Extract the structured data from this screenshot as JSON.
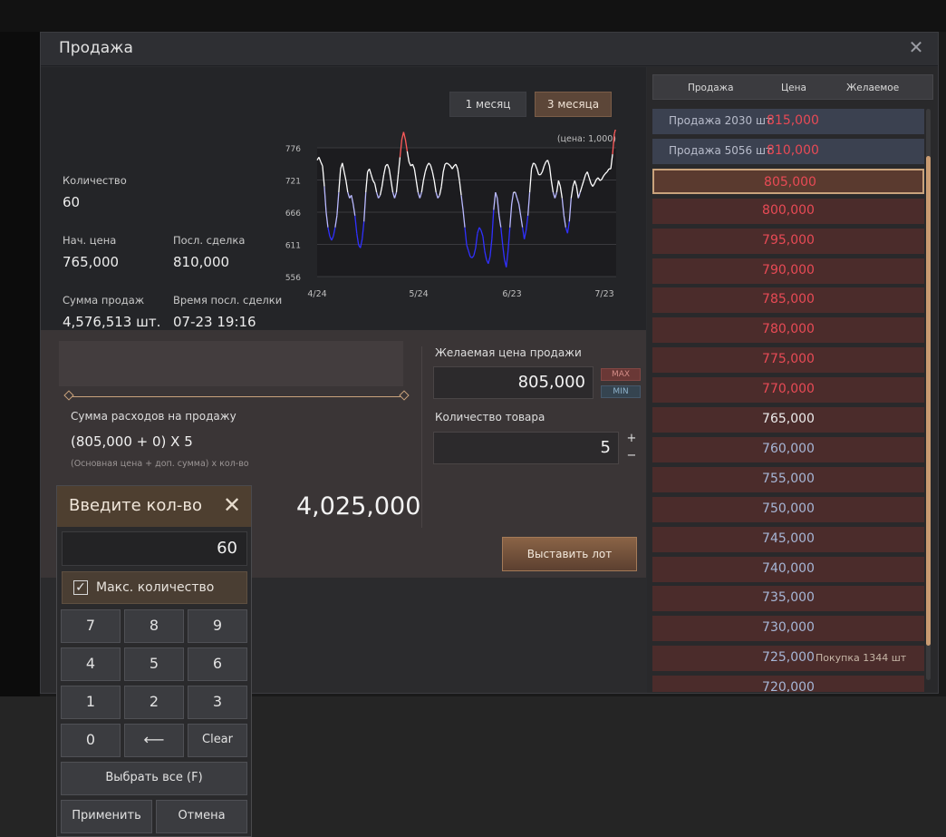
{
  "window": {
    "title": "Продажа"
  },
  "period_buttons": {
    "one_month": "1 месяц",
    "three_months": "3 месяца"
  },
  "stats": {
    "quantity_label": "Количество",
    "quantity_value": "60",
    "start_price_label": "Нач. цена",
    "start_price_value": "765,000",
    "last_deal_label": "Посл. сделка",
    "last_deal_value": "810,000",
    "sales_sum_label": "Сумма продаж",
    "sales_sum_value": "4,576,513 шт.",
    "last_deal_time_label": "Время посл. сделки",
    "last_deal_time_value": "07-23 19:16"
  },
  "chart_data": {
    "type": "line",
    "unit_note": "(цена: 1,000)",
    "y_ticks": [
      "776",
      "721",
      "666",
      "611",
      "556"
    ],
    "ylim": [
      556,
      776
    ],
    "x_ticks": [
      "4/24",
      "5/24",
      "6/23",
      "7/23"
    ],
    "reference_line": 765,
    "values": [
      755,
      760,
      752,
      745,
      710,
      666,
      640,
      625,
      618,
      625,
      640,
      660,
      700,
      740,
      750,
      735,
      720,
      700,
      690,
      695,
      680,
      660,
      630,
      610,
      605,
      620,
      650,
      700,
      735,
      740,
      730,
      720,
      715,
      700,
      690,
      695,
      710,
      730,
      745,
      748,
      740,
      720,
      700,
      690,
      700,
      730,
      760,
      790,
      803,
      790,
      770,
      752,
      745,
      748,
      740,
      720,
      700,
      690,
      700,
      720,
      735,
      745,
      750,
      746,
      735,
      720,
      700,
      690,
      695,
      710,
      735,
      748,
      750,
      748,
      745,
      740,
      745,
      748,
      740,
      720,
      695,
      670,
      640,
      610,
      600,
      590,
      588,
      592,
      605,
      630,
      640,
      635,
      625,
      600,
      585,
      578,
      590,
      620,
      670,
      700,
      690,
      660,
      640,
      610,
      585,
      572,
      600,
      640,
      680,
      700,
      700,
      690,
      680,
      660,
      640,
      620,
      635,
      660,
      700,
      740,
      750,
      748,
      740,
      730,
      730,
      735,
      745,
      752,
      755,
      745,
      720,
      700,
      690,
      700,
      720,
      710,
      690,
      660,
      640,
      630,
      650,
      690,
      710,
      720,
      710,
      690,
      700,
      710,
      720,
      730,
      735,
      725,
      715,
      710,
      715,
      722,
      725,
      720,
      722,
      728,
      732,
      735,
      740,
      740,
      765,
      800,
      812
    ]
  },
  "sell_form": {
    "cost_label": "Сумма расходов на продажу",
    "cost_formula": "(805,000 + 0) X 5",
    "cost_note": "(Основная цена + доп. сумма) x кол-во",
    "total": "4,025,000",
    "price_label": "Желаемая цена продажи",
    "price_value": "805,000",
    "max_label": "MAX",
    "min_label": "MIN",
    "qty_label": "Количество товара",
    "qty_value": "5",
    "plus": "+",
    "minus": "−",
    "submit_label": "Выставить лот"
  },
  "price_list": {
    "headers": [
      "Продажа",
      "Цена",
      "Желаемое"
    ],
    "rows": [
      {
        "desc": "Продажа 2030 шт",
        "price": "815,000",
        "color": "red",
        "kind": "sell"
      },
      {
        "desc": "Продажа 5056 шт",
        "price": "810,000",
        "color": "red",
        "kind": "sell"
      },
      {
        "desc": "",
        "price": "805,000",
        "color": "red",
        "kind": "selected"
      },
      {
        "desc": "",
        "price": "800,000",
        "color": "red",
        "kind": "price"
      },
      {
        "desc": "",
        "price": "795,000",
        "color": "red",
        "kind": "price"
      },
      {
        "desc": "",
        "price": "790,000",
        "color": "red",
        "kind": "price"
      },
      {
        "desc": "",
        "price": "785,000",
        "color": "red",
        "kind": "price"
      },
      {
        "desc": "",
        "price": "780,000",
        "color": "red",
        "kind": "price"
      },
      {
        "desc": "",
        "price": "775,000",
        "color": "red",
        "kind": "price"
      },
      {
        "desc": "",
        "price": "770,000",
        "color": "red",
        "kind": "price"
      },
      {
        "desc": "",
        "price": "765,000",
        "color": "white",
        "kind": "price"
      },
      {
        "desc": "",
        "price": "760,000",
        "color": "blue",
        "kind": "price"
      },
      {
        "desc": "",
        "price": "755,000",
        "color": "blue",
        "kind": "price"
      },
      {
        "desc": "",
        "price": "750,000",
        "color": "blue",
        "kind": "price"
      },
      {
        "desc": "",
        "price": "745,000",
        "color": "blue",
        "kind": "price"
      },
      {
        "desc": "",
        "price": "740,000",
        "color": "blue",
        "kind": "price"
      },
      {
        "desc": "",
        "price": "735,000",
        "color": "blue",
        "kind": "price"
      },
      {
        "desc": "",
        "price": "730,000",
        "color": "blue",
        "kind": "price"
      },
      {
        "desc": "",
        "price": "725,000",
        "color": "blue",
        "kind": "price",
        "buy": "Покупка 1344 шт"
      },
      {
        "desc": "",
        "price": "720,000",
        "color": "blue",
        "kind": "price"
      }
    ]
  },
  "numpad": {
    "title": "Введите кол-во",
    "display": "60",
    "max_checkbox_label": "Макс. количество",
    "keys": [
      "7",
      "8",
      "9",
      "4",
      "5",
      "6",
      "1",
      "2",
      "3",
      "0",
      "⟵",
      "Clear"
    ],
    "select_all": "Выбрать все (F)",
    "apply": "Применить",
    "cancel": "Отмена"
  },
  "colors": {
    "accent_gold": "#c9a27c",
    "price_red": "#e84a55",
    "price_blue": "#a6b6d6",
    "chart_up": "#ff6060",
    "chart_down": "#2727ff"
  }
}
